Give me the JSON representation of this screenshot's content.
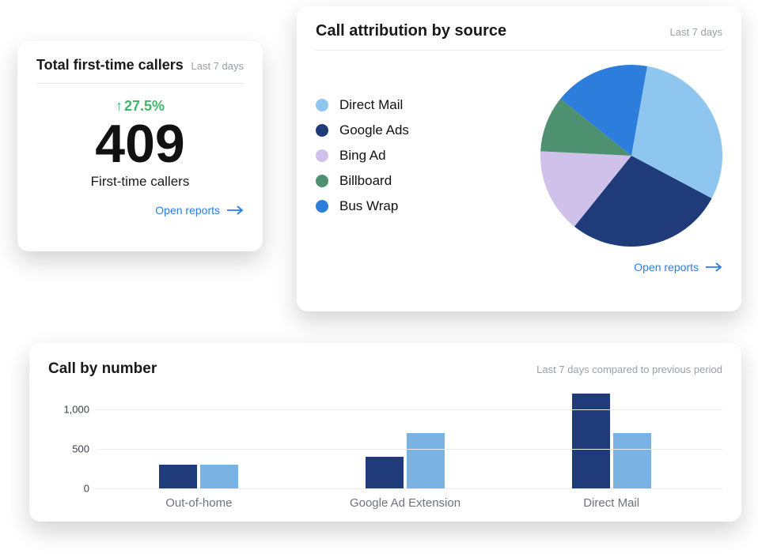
{
  "cards": {
    "ftc": {
      "title": "Total first-time callers",
      "subtitle": "Last 7 days",
      "trend_pct": "27.5%",
      "value": "409",
      "value_label": "First-time callers",
      "open_reports": "Open reports"
    },
    "attr": {
      "title": "Call attribution by source",
      "subtitle": "Last 7 days",
      "open_reports": "Open reports",
      "legend": [
        {
          "label": "Direct Mail",
          "color": "#8ec6ef"
        },
        {
          "label": "Google Ads",
          "color": "#1f3b7a"
        },
        {
          "label": "Bing Ad",
          "color": "#cfc1ea"
        },
        {
          "label": "Billboard",
          "color": "#4d9171"
        },
        {
          "label": "Bus Wrap",
          "color": "#2d7ddc"
        }
      ]
    },
    "bar": {
      "title": "Call by number",
      "subtitle": "Last 7 days compared to previous period"
    }
  },
  "chart_data": [
    {
      "type": "pie",
      "title": "Call attribution by source",
      "series": [
        {
          "name": "Direct Mail",
          "value": 30,
          "color": "#8ec6ef"
        },
        {
          "name": "Google Ads",
          "value": 28,
          "color": "#1f3b7a"
        },
        {
          "name": "Bing Ad",
          "value": 15,
          "color": "#cfc1ea"
        },
        {
          "name": "Billboard",
          "value": 10,
          "color": "#4d9171"
        },
        {
          "name": "Bus Wrap",
          "value": 17,
          "color": "#2d7ddc"
        }
      ]
    },
    {
      "type": "bar",
      "title": "Call by number",
      "categories": [
        "Out-of-home",
        "Google Ad Extension",
        "Direct Mail"
      ],
      "series": [
        {
          "name": "Previous period",
          "color": "#1f3b7a",
          "values": [
            300,
            400,
            1200
          ]
        },
        {
          "name": "Last 7 days",
          "color": "#7ab2e3",
          "values": [
            300,
            700,
            700
          ]
        }
      ],
      "y_ticks": [
        0,
        500,
        1000
      ],
      "ylim": [
        0,
        1300
      ],
      "ylabel": "",
      "xlabel": ""
    }
  ]
}
